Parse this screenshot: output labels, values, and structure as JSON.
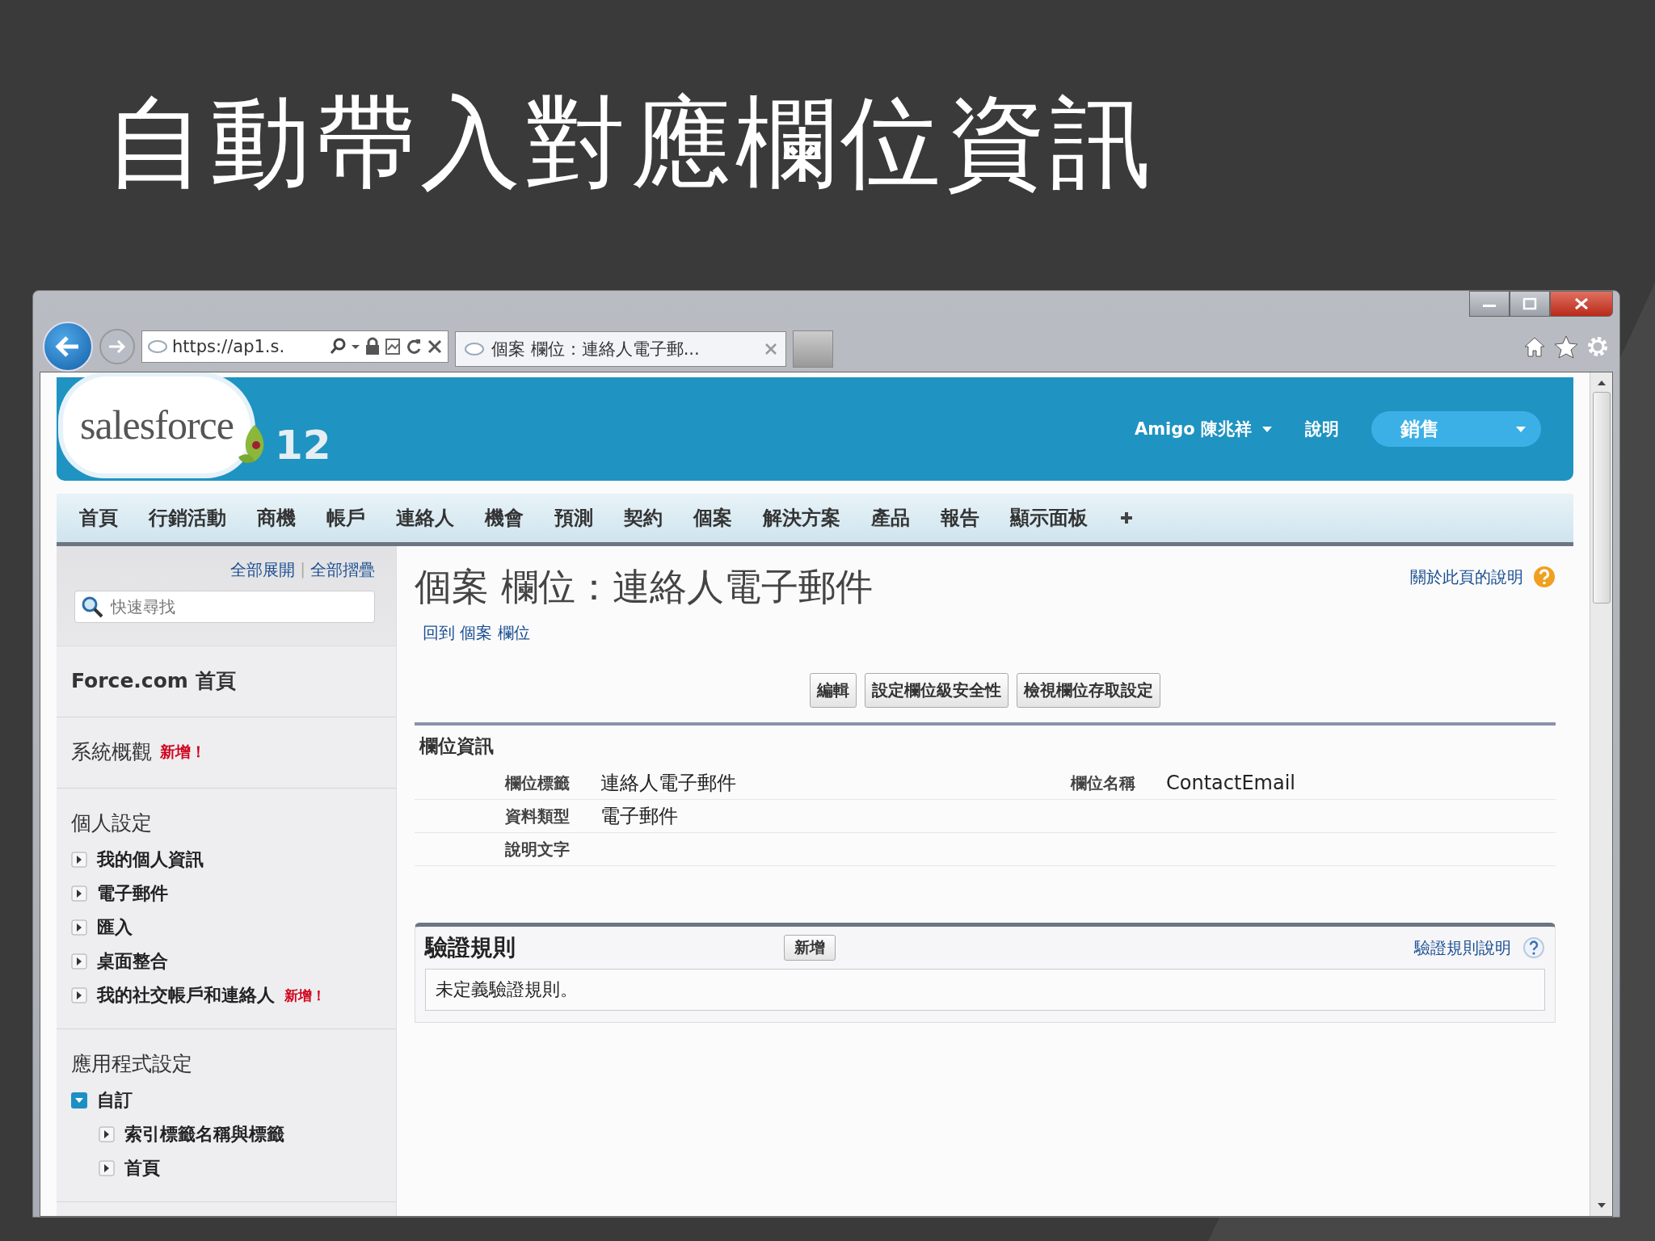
{
  "slide": {
    "title": "自動帶入對應欄位資訊"
  },
  "browser": {
    "address": "https://ap1.s.",
    "tab_title": "個案 欄位：連絡人電子郵..."
  },
  "header": {
    "logo_text": "salesforce",
    "version": "12",
    "user": "Amigo 陳兆祥",
    "help": "說明",
    "app_menu": "銷售"
  },
  "nav_tabs": [
    "首頁",
    "行銷活動",
    "商機",
    "帳戶",
    "連絡人",
    "機會",
    "預測",
    "契約",
    "個案",
    "解決方案",
    "產品",
    "報告",
    "顯示面板"
  ],
  "sidebar": {
    "expand_all": "全部展開",
    "separator": "|",
    "collapse_all": "全部摺疊",
    "search": {
      "placeholder": "快速尋找"
    },
    "sections": [
      {
        "title": "Force.com 首頁",
        "kind": "home"
      },
      {
        "title": "系統概觀",
        "kind": "plain",
        "badge": "新增！"
      },
      {
        "title": "個人設定",
        "kind": "plain",
        "items": [
          {
            "label": "我的個人資訊",
            "expanded": false
          },
          {
            "label": "電子郵件",
            "expanded": false
          },
          {
            "label": "匯入",
            "expanded": false
          },
          {
            "label": "桌面整合",
            "expanded": false
          },
          {
            "label": "我的社交帳戶和連絡人",
            "expanded": false,
            "badge": "新增！"
          }
        ]
      },
      {
        "title": "應用程式設定",
        "kind": "plain",
        "items": [
          {
            "label": "自訂",
            "expanded": true,
            "children": [
              {
                "label": "索引標籤名稱與標籤",
                "expanded": false
              },
              {
                "label": "首頁",
                "expanded": false
              }
            ]
          }
        ]
      }
    ]
  },
  "content": {
    "title": "個案 欄位：連絡人電子郵件",
    "back_link": "回到 個案 欄位",
    "help_link": "關於此頁的說明",
    "buttons": [
      "編輯",
      "設定欄位級安全性",
      "檢視欄位存取設定"
    ],
    "field_info": {
      "heading": "欄位資訊",
      "rows": [
        {
          "cells": [
            {
              "label": "欄位標籤",
              "value": "連絡人電子郵件"
            },
            {
              "label": "欄位名稱",
              "value": "ContactEmail"
            }
          ]
        },
        {
          "cells": [
            {
              "label": "資料類型",
              "value": "電子郵件"
            }
          ]
        },
        {
          "cells": [
            {
              "label": "說明文字"
            }
          ]
        }
      ]
    },
    "validation": {
      "heading": "驗證規則",
      "new_button": "新增",
      "help_link": "驗證規則說明",
      "empty_message": "未定義驗證規則。"
    }
  }
}
